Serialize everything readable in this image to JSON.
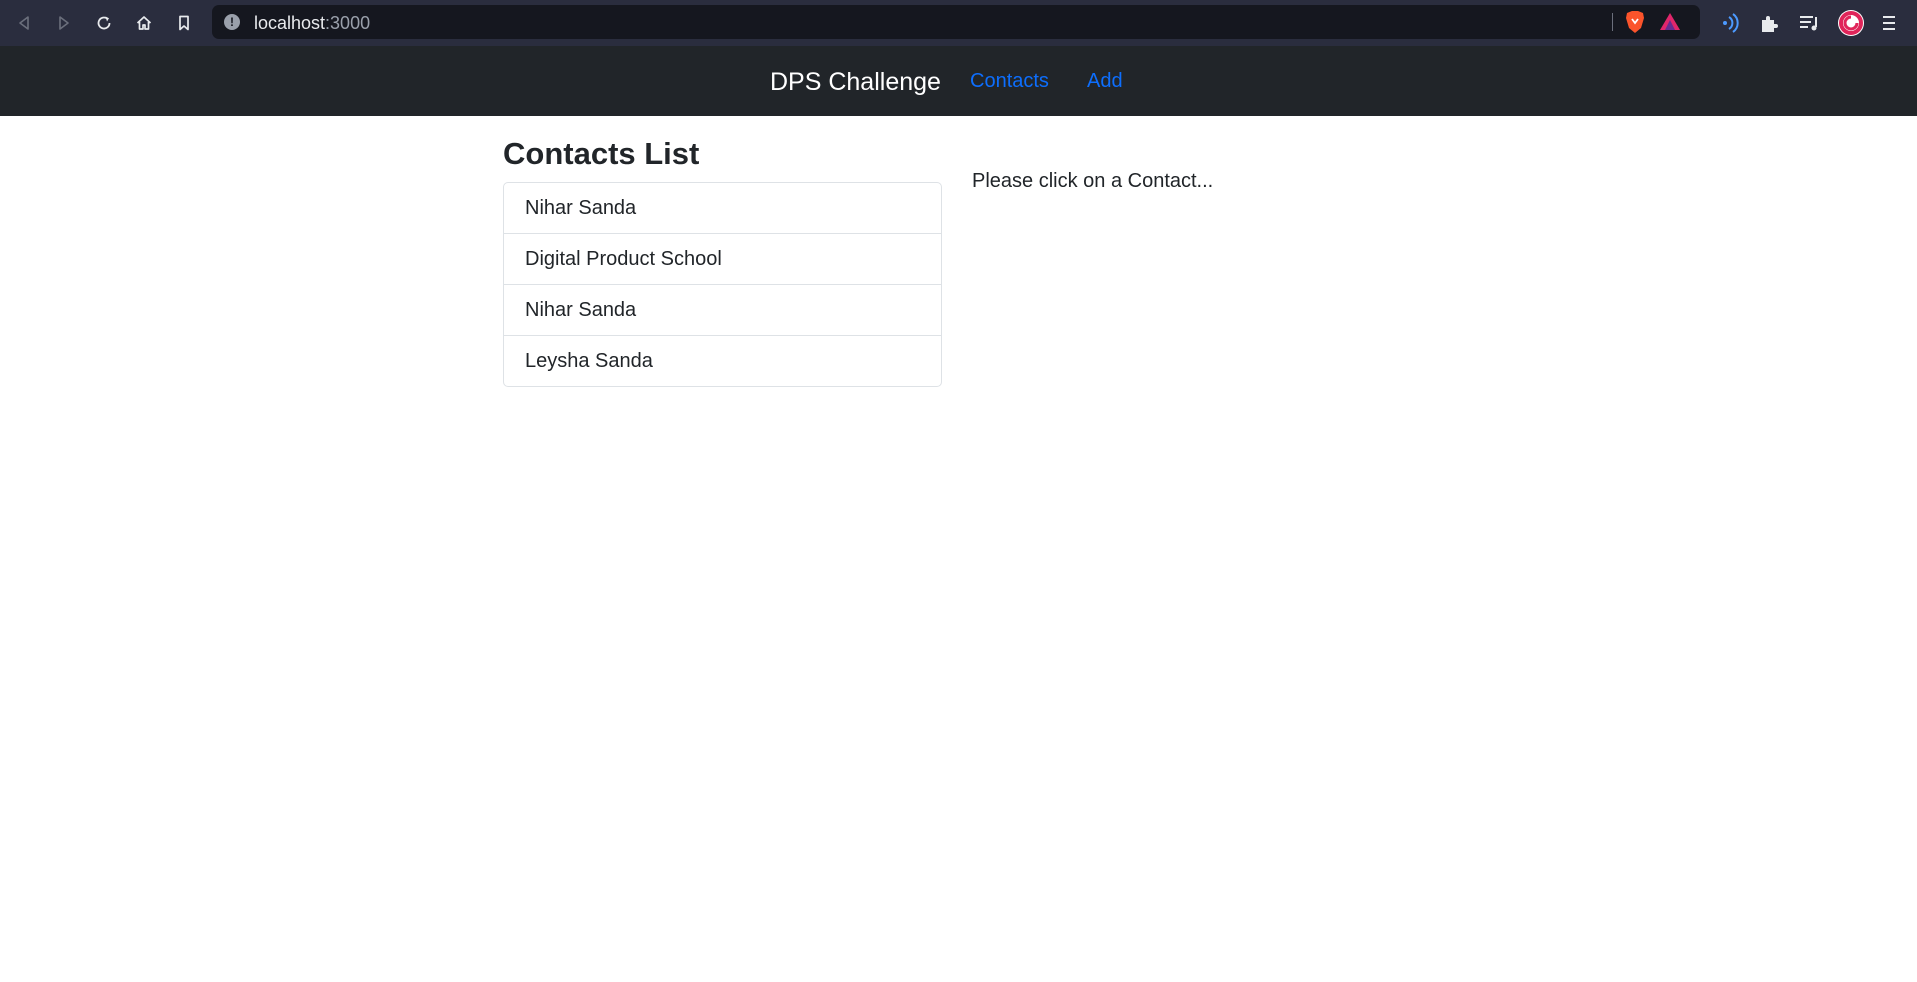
{
  "browser": {
    "url_host": "localhost",
    "url_port": ":3000",
    "icons": [
      "back-icon",
      "forward-icon",
      "reload-icon",
      "home-icon",
      "bookmark-icon",
      "site-info-icon",
      "brave-shields-icon",
      "brave-rewards-icon",
      "speedreader-icon",
      "extensions-icon",
      "playlist-icon",
      "profile-icon",
      "menu-icon"
    ]
  },
  "navbar": {
    "brand": "DPS Challenge",
    "links": [
      {
        "label": "Contacts"
      },
      {
        "label": "Add"
      }
    ],
    "link_color": "#0d6efd",
    "background": "#212529"
  },
  "main": {
    "title": "Contacts List",
    "contacts": [
      {
        "name": "Nihar Sanda"
      },
      {
        "name": "Digital Product School"
      },
      {
        "name": "Nihar Sanda"
      },
      {
        "name": "Leysha Sanda"
      }
    ],
    "hint": "Please click on a Contact..."
  }
}
